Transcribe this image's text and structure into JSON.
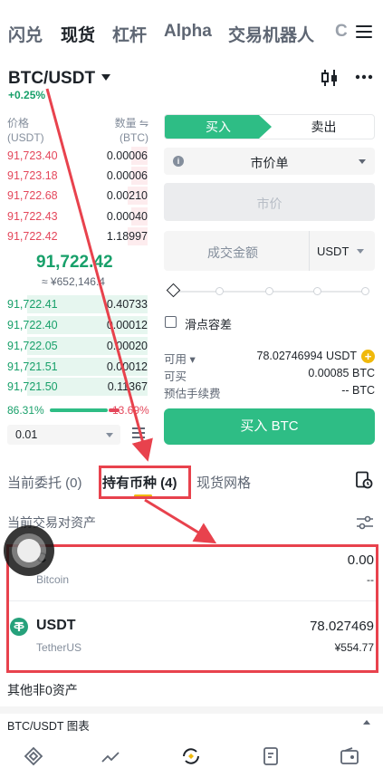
{
  "top_tabs": [
    "闪兑",
    "现货",
    "杠杆",
    "Alpha",
    "交易机器人",
    "C"
  ],
  "pair": {
    "symbol": "BTC/USDT",
    "change": "+0.25%"
  },
  "order_book": {
    "price_header": "价格",
    "price_unit": "(USDT)",
    "qty_header": "数量",
    "qty_unit": "(BTC)",
    "asks": [
      {
        "price": "91,723.40",
        "qty": "0.00006",
        "depth": 0.1
      },
      {
        "price": "91,723.18",
        "qty": "0.00006",
        "depth": 0.1
      },
      {
        "price": "91,722.68",
        "qty": "0.00210",
        "depth": 0.15
      },
      {
        "price": "91,722.43",
        "qty": "0.00040",
        "depth": 0.1
      },
      {
        "price": "91,722.42",
        "qty": "1.18997",
        "depth": 0.15
      }
    ],
    "last_price": "91,722.42",
    "last_price_cny": "≈ ¥652,146.4",
    "bids": [
      {
        "price": "91,722.41",
        "qty": "0.40733",
        "depth": 0.8
      },
      {
        "price": "91,722.40",
        "qty": "0.00012",
        "depth": 0.8
      },
      {
        "price": "91,722.05",
        "qty": "0.00020",
        "depth": 0.8
      },
      {
        "price": "91,721.51",
        "qty": "0.00012",
        "depth": 0.8
      },
      {
        "price": "91,721.50",
        "qty": "0.11367",
        "depth": 0.8
      }
    ],
    "buy_ratio": "86.31%",
    "sell_ratio": "13.69%",
    "precision": "0.01"
  },
  "form": {
    "buy_tab": "买入",
    "sell_tab": "卖出",
    "order_type": "市价单",
    "price_placeholder": "市价",
    "amount_placeholder": "成交金额",
    "amount_unit": "USDT",
    "slippage_label": "滑点容差",
    "available_label": "可用",
    "available_value": "78.02746994 USDT",
    "can_buy_label": "可买",
    "can_buy_value": "0.00085 BTC",
    "fee_label": "预估手续费",
    "fee_value": "-- BTC",
    "buy_button": "买入 BTC"
  },
  "sections": {
    "tabs": [
      "当前委托 (0)",
      "持有币种 (4)",
      "现货网格"
    ],
    "current_pair_assets": "当前交易对资产",
    "other_assets": "其他非0资产",
    "chart_bar": "BTC/USDT 图表"
  },
  "assets": [
    {
      "symbol": "BTC",
      "visible_symbol": "C",
      "name": "Bitcoin",
      "amount": "0.00",
      "value": "--"
    },
    {
      "symbol": "USDT",
      "name": "TetherUS",
      "amount": "78.027469",
      "value": "¥554.77"
    }
  ],
  "colors": {
    "buy": "#2ebd85",
    "sell": "#e4475b",
    "annotation": "#e8424d"
  }
}
